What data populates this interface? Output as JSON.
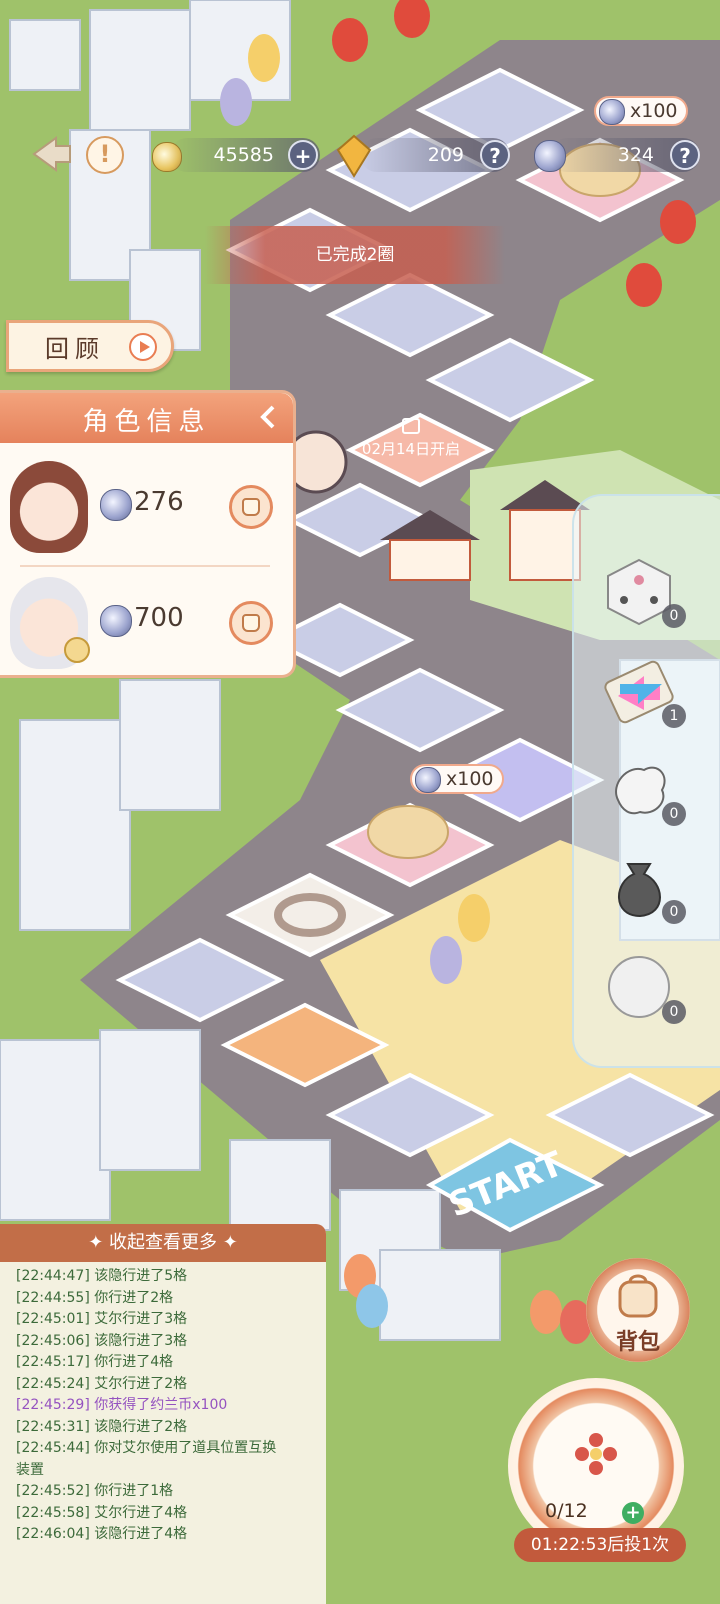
{
  "top_bar": {
    "back_icon": "back-arrow-icon",
    "notice_icon": "exclamation-icon",
    "gold_value": "45585",
    "gem_value": "209",
    "token_value": "324",
    "plus_label": "+",
    "help_label": "?"
  },
  "board": {
    "rounds_banner": "已完成2圈",
    "lock_tile_text": "02月14日开启",
    "reward_top_label": "x100",
    "reward_mid_label": "x100",
    "start_label": "START"
  },
  "review_button": {
    "label": "回顾"
  },
  "role_panel": {
    "title": "角色信息",
    "roles": [
      {
        "value": "276",
        "icon": "bag-icon"
      },
      {
        "value": "700",
        "icon": "bag-icon"
      }
    ]
  },
  "items": [
    {
      "name": "flower-dice",
      "count": "0"
    },
    {
      "name": "swap-arrows",
      "count": "1"
    },
    {
      "name": "glove-hand",
      "count": "0"
    },
    {
      "name": "sack",
      "count": "0"
    },
    {
      "name": "snowball",
      "count": "0"
    }
  ],
  "log": {
    "header": "收起查看更多",
    "lines": [
      "[22:44:47] 该隐行进了5格",
      "[22:44:55] 你行进了2格",
      "[22:45:01] 艾尔行进了3格",
      "[22:45:06] 该隐行进了3格",
      "[22:45:17] 你行进了4格",
      "[22:45:24] 艾尔行进了2格",
      "[22:45:29] 你获得了约兰币x100",
      "[22:45:31] 该隐行进了2格",
      "[22:45:44] 你对艾尔使用了道具位置互换",
      "装置",
      "[22:45:52] 你行进了1格",
      "[22:45:58] 艾尔行进了4格",
      "[22:46:04] 该隐行进了4格"
    ]
  },
  "backpack": {
    "label": "背包"
  },
  "dice": {
    "count": "0/12",
    "plus": "+",
    "timer": "01:22:53后投1次"
  },
  "colors": {
    "accent": "#e5825c",
    "grass": "#9fc26a",
    "road": "#8a7f86",
    "tile": "#c9cde6"
  }
}
